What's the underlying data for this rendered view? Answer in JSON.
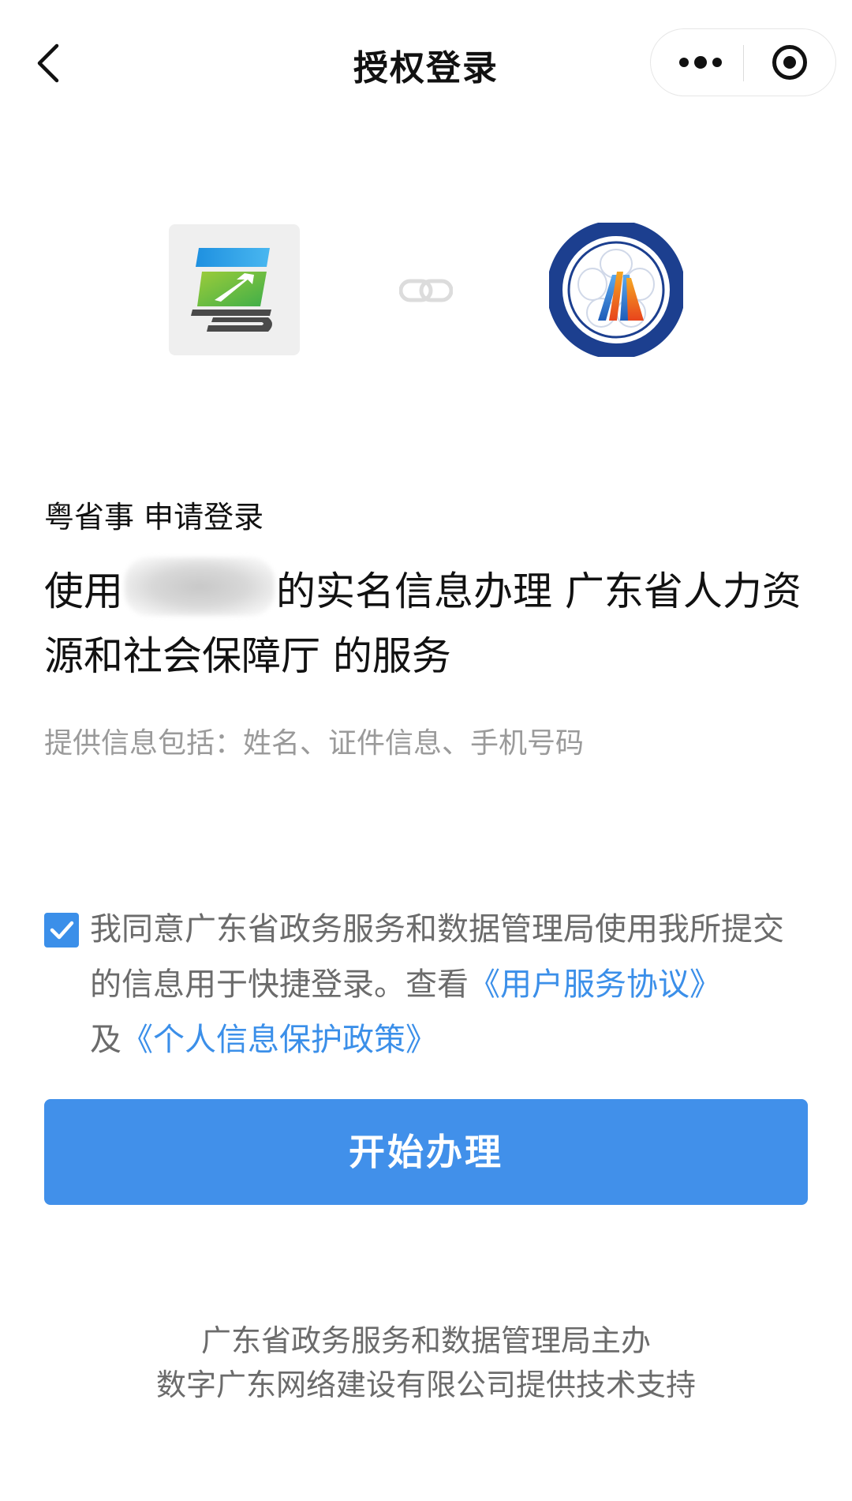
{
  "nav": {
    "title": "授权登录",
    "back_icon": "chevron-left-icon",
    "more_icon": "more-dots-icon",
    "close_icon": "target-close-icon"
  },
  "logos": {
    "app_logo_icon": "yue-app-logo",
    "link_icon": "link-icon",
    "org_logo_icon": "hrss-emblem-logo"
  },
  "request": {
    "app_name": "粤省事",
    "apply_text": "申请登录"
  },
  "main": {
    "prefix": "使用",
    "suffix": "的实名信息办理 广东省人力资源和社会保障厅 的服务"
  },
  "info": {
    "text": "提供信息包括：姓名、证件信息、手机号码"
  },
  "agreement": {
    "checked": true,
    "text": "我同意广东省政务服务和数据管理局使用我所提交的信息用于快捷登录。查看",
    "link_user_agreement": "《用户服务协议》",
    "and": "及",
    "link_privacy": "《个人信息保护政策》",
    "link_color": "#3b8fe9"
  },
  "action": {
    "primary_label": "开始办理",
    "primary_color": "#4190ea"
  },
  "footer": {
    "line1": "广东省政务服务和数据管理局主办",
    "line2": "数字广东网络建设有限公司提供技术支持"
  }
}
